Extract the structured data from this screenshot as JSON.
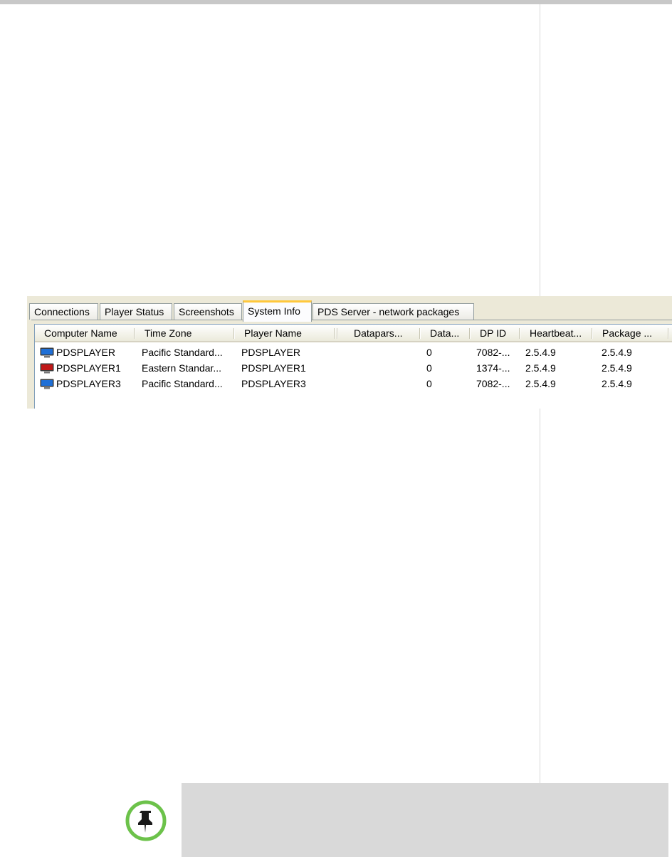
{
  "tabs": [
    {
      "label": "Connections",
      "active": false
    },
    {
      "label": "Player Status",
      "active": false
    },
    {
      "label": "Screenshots",
      "active": false
    },
    {
      "label": "System Info",
      "active": true
    },
    {
      "label": "PDS Server - network packages",
      "active": false
    }
  ],
  "table": {
    "columns": [
      "Computer Name",
      "Time Zone",
      "Player Name",
      "Datapars...",
      "Data...",
      "DP ID",
      "Heartbeat...",
      "Package ..."
    ],
    "rows": [
      {
        "status_color": "#1f6fd6",
        "cells": [
          "PDSPLAYER",
          "Pacific Standard...",
          "PDSPLAYER",
          "",
          "0",
          "7082-...",
          "2.5.4.9",
          "2.5.4.9"
        ]
      },
      {
        "status_color": "#c01818",
        "cells": [
          "PDSPLAYER1",
          "Eastern Standar...",
          "PDSPLAYER1",
          "",
          "0",
          "1374-...",
          "2.5.4.9",
          "2.5.4.9"
        ]
      },
      {
        "status_color": "#1f6fd6",
        "cells": [
          "PDSPLAYER3",
          "Pacific Standard...",
          "PDSPLAYER3",
          "",
          "0",
          "7082-...",
          "2.5.4.9",
          "2.5.4.9"
        ]
      }
    ]
  },
  "icons": {
    "row_icon": "monitor-icon",
    "note_icon": "pushpin-icon"
  },
  "colors": {
    "note_icon_ring": "#6cc24a",
    "note_background": "#d9d9d9",
    "active_tab_accent": "#ffc83c"
  }
}
